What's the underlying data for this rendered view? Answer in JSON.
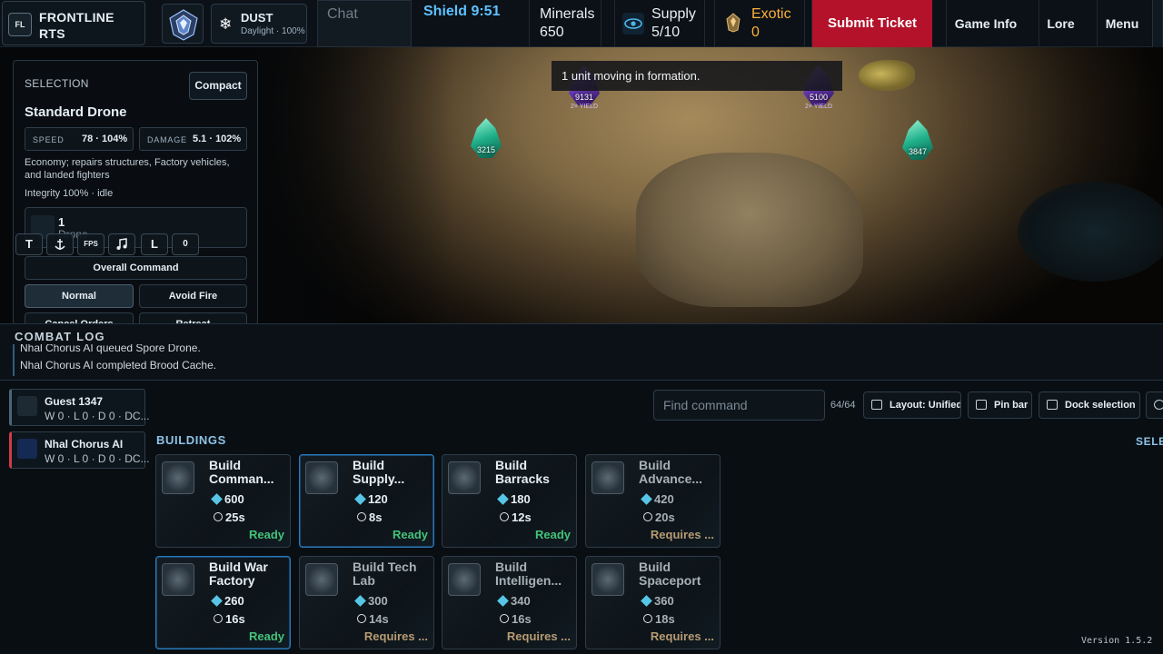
{
  "brand": {
    "logo": "FL",
    "name": "FRONTLINE RTS"
  },
  "weather": {
    "icon": "snowflake-icon",
    "title": "DUST",
    "subtitle": "Daylight · 100%"
  },
  "chat": {
    "placeholder": "Chat"
  },
  "shield": "Shield 9:51",
  "resources": {
    "minerals": {
      "label": "Minerals",
      "value": "650"
    },
    "supply": {
      "label": "Supply",
      "value": "5/10",
      "icon": "eye-icon"
    },
    "exotic": {
      "label": "Exotic",
      "value": "0",
      "icon": "exotic-crystal-icon"
    }
  },
  "nav": {
    "submit": "Submit Ticket",
    "game_info": "Game Info",
    "lore": "Lore",
    "menu": "Menu"
  },
  "map": {
    "toast": "1 unit moving in formation.",
    "nodes": [
      {
        "type": "green",
        "amount": "3215"
      },
      {
        "type": "purple",
        "amount": "9131",
        "yield": "2× YIELD"
      },
      {
        "type": "purple",
        "amount": "5100",
        "yield": "2× YIELD"
      },
      {
        "type": "green",
        "amount": "3847"
      }
    ]
  },
  "selection": {
    "caption": "SELECTION",
    "compact_label": "Compact",
    "unit_name": "Standard Drone",
    "speed_label": "SPEED",
    "speed_value": "78 · 104%",
    "damage_label": "DAMAGE",
    "damage_value": "5.1 · 102%",
    "description": "Economy; repairs structures, Factory vehicles, and landed fighters",
    "integrity": "Integrity 100% · idle",
    "roster_count": "1",
    "roster_name": "Drone",
    "mini_buttons": [
      "T",
      "",
      "FPS",
      "",
      "L",
      "0"
    ],
    "overall_command": "Overall Command",
    "stances": [
      "Normal",
      "Avoid Fire"
    ],
    "more_commands": [
      "Cancel Orders",
      "Retreat"
    ]
  },
  "combat_log": {
    "title": "COMBAT LOG",
    "lines": [
      "Nhal Chorus AI queued Spore Drone.",
      "Nhal Chorus AI completed Brood Cache."
    ]
  },
  "players": [
    {
      "name": "Guest 1347",
      "stats": "W 0 · L 0 · D 0 · DC..."
    },
    {
      "name": "Nhal Chorus AI",
      "stats": "W 0 · L 0 · D 0 · DC..."
    }
  ],
  "commands": {
    "search_placeholder": "Find command",
    "count": "64/64",
    "layout": "Layout: Unified",
    "pin": "Pin bar",
    "dock": "Dock selection",
    "section": "BUILDINGS",
    "section_right": "SELE",
    "cards": [
      {
        "line1": "Build",
        "line2": "Comman...",
        "cost": "600",
        "time": "25s",
        "status": "Ready"
      },
      {
        "line1": "Build",
        "line2": "Supply...",
        "cost": "120",
        "time": "8s",
        "status": "Ready"
      },
      {
        "line1": "Build",
        "line2": "Barracks",
        "cost": "180",
        "time": "12s",
        "status": "Ready"
      },
      {
        "line1": "Build",
        "line2": "Advance...",
        "cost": "420",
        "time": "20s",
        "status": "Requires ..."
      },
      {
        "line1": "Build War",
        "line2": "Factory",
        "cost": "260",
        "time": "16s",
        "status": "Ready"
      },
      {
        "line1": "Build Tech",
        "line2": "Lab",
        "cost": "300",
        "time": "14s",
        "status": "Requires ..."
      },
      {
        "line1": "Build",
        "line2": "Intelligen...",
        "cost": "340",
        "time": "16s",
        "status": "Requires ..."
      },
      {
        "line1": "Build",
        "line2": "Spaceport",
        "cost": "360",
        "time": "18s",
        "status": "Requires ..."
      }
    ]
  },
  "version": "Version 1.5.2"
}
